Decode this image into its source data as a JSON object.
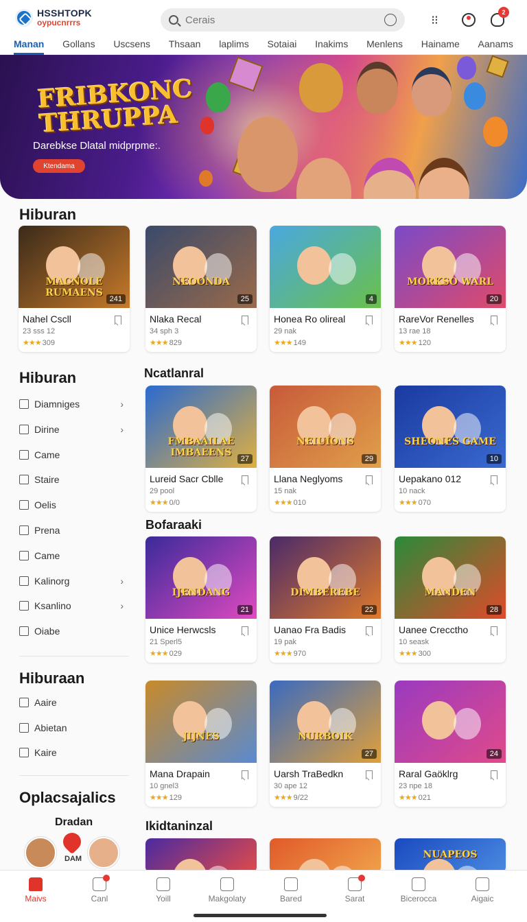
{
  "header": {
    "logo_top": "HSSHTOPK",
    "logo_bottom": "oypucnrrrs",
    "search_placeholder": "Cerais",
    "notification_count": "2",
    "tabs": [
      "Manan",
      "Gollans",
      "Uscsens",
      "Thsaan",
      "laplims",
      "Sotaiai",
      "Inakims",
      "Menlens",
      "Hainame",
      "Aanams"
    ]
  },
  "hero": {
    "title": "FRIBKONC THRUPPA",
    "subtitle": "Darebkse Dlatal midprpme:.",
    "button_label": "Ktendama"
  },
  "section1": {
    "title": "Hiburan"
  },
  "row1": [
    {
      "title": "Nahel Cscll",
      "meta": "23 sss 12",
      "rating": "309",
      "badge": "241",
      "thumb_text": "MACNOLE RUMAENS",
      "colors": [
        "#3a2a1a",
        "#c77a2a"
      ]
    },
    {
      "title": "Nlaka Recal",
      "meta": "34 sph 3",
      "rating": "829",
      "badge": "25",
      "thumb_text": "NEOONDA",
      "colors": [
        "#3a4a6a",
        "#9a6a4a"
      ]
    },
    {
      "title": "Honea Ro olireal",
      "meta": "29 nak",
      "rating": "149",
      "badge": "4",
      "thumb_text": "",
      "colors": [
        "#4aa8e0",
        "#6ac04a"
      ]
    },
    {
      "title": "RareVor Renelles",
      "meta": "13 rae 18",
      "rating": "120",
      "badge": "20",
      "thumb_text": "MORKSO WARL",
      "colors": [
        "#7a4ac8",
        "#e04a6a"
      ]
    }
  ],
  "sidebar1": {
    "title": "Hiburan",
    "items": [
      {
        "label": "Diamniges",
        "chevron": true
      },
      {
        "label": "Dirine",
        "chevron": true
      },
      {
        "label": "Came",
        "chevron": false
      },
      {
        "label": "Staire",
        "chevron": false
      },
      {
        "label": "Oelis",
        "chevron": false
      },
      {
        "label": "Prena",
        "chevron": false
      },
      {
        "label": "Came",
        "chevron": false
      },
      {
        "label": "Kalinorg",
        "chevron": true
      },
      {
        "label": "Ksanlino",
        "chevron": true
      },
      {
        "label": "Oiabe",
        "chevron": false
      }
    ]
  },
  "sidebar2": {
    "title": "Hiburaan",
    "items": [
      {
        "label": "Aaire"
      },
      {
        "label": "Abietan"
      },
      {
        "label": "Kaire"
      }
    ]
  },
  "sidebar3": {
    "title": "Oplacsajalics",
    "sub": "Dradan",
    "avatar_label": "DAM"
  },
  "sub_section2": {
    "title": "Ncatlanral"
  },
  "row2": [
    {
      "title": "Lureid Sacr Cblle",
      "meta": "29 pool",
      "rating": "0/0",
      "badge": "27",
      "thumb_text": "FMBAAILAE IMBAEENS",
      "colors": [
        "#2a6ad0",
        "#e0b040"
      ]
    },
    {
      "title": "Llana Neglyoms",
      "meta": "15 nak",
      "rating": "010",
      "badge": "29",
      "thumb_text": "NEIUIONS",
      "colors": [
        "#c85a3a",
        "#e0a04a"
      ]
    },
    {
      "title": "Uepakano 012",
      "meta": "10 nack",
      "rating": "070",
      "badge": "10",
      "thumb_text": "SHEONES GAME",
      "colors": [
        "#1a3aa0",
        "#3a6ad0"
      ]
    }
  ],
  "sub_section3": {
    "title": "Bofaraaki"
  },
  "row3": [
    {
      "title": "Unice Herwcsls",
      "meta": "21 Sperl5",
      "rating": "029",
      "badge": "21",
      "thumb_text": "IJENDANG",
      "colors": [
        "#3a2a9a",
        "#e04ac0"
      ]
    },
    {
      "title": "Uanao Fra Badis",
      "meta": "19 pak",
      "rating": "970",
      "badge": "22",
      "thumb_text": "DIMBEREBE",
      "colors": [
        "#4a2a6a",
        "#e07a2a"
      ]
    },
    {
      "title": "Uanee Crecctho",
      "meta": "10 seask",
      "rating": "300",
      "badge": "28",
      "thumb_text": "MANDEN",
      "colors": [
        "#2a8a3a",
        "#e04a2a"
      ]
    }
  ],
  "row4": [
    {
      "title": "Mana Drapain",
      "meta": "10 gnel3",
      "rating": "129",
      "badge": "",
      "thumb_text": "JIJNES",
      "colors": [
        "#c88a2a",
        "#5a8ad0"
      ]
    },
    {
      "title": "Uarsh TraBedkn",
      "meta": "30 ape 12",
      "rating": "9/22",
      "badge": "27",
      "thumb_text": "NURBOIK",
      "colors": [
        "#3a6ac0",
        "#e0a03a"
      ]
    },
    {
      "title": "Raral Gaöklrg",
      "meta": "23 npe 18",
      "rating": "021",
      "badge": "24",
      "thumb_text": "",
      "colors": [
        "#9a3ac0",
        "#e04a8a"
      ]
    }
  ],
  "sub_section5": {
    "title": "Ikidtaninzal"
  },
  "row5": [
    {
      "thumb_text": "",
      "colors": [
        "#4a2aa0",
        "#e04a4a"
      ]
    },
    {
      "thumb_text": "",
      "colors": [
        "#e05a2a",
        "#f0a04a"
      ]
    },
    {
      "thumb_text": "NUAPEOS",
      "colors": [
        "#1a4ac0",
        "#4a8ae0"
      ]
    }
  ],
  "bottom_nav": [
    {
      "label": "Maivs",
      "icon": "home-icon",
      "active": true,
      "dot": false
    },
    {
      "label": "Canl",
      "icon": "clock-icon",
      "active": false,
      "dot": true
    },
    {
      "label": "Yoill",
      "icon": "star-icon",
      "active": false,
      "dot": false
    },
    {
      "label": "Makgolaty",
      "icon": "chat-icon",
      "active": false,
      "dot": false
    },
    {
      "label": "Bared",
      "icon": "box-icon",
      "active": false,
      "dot": false
    },
    {
      "label": "Sarat",
      "icon": "grid-icon",
      "active": false,
      "dot": true
    },
    {
      "label": "Bicerocca",
      "icon": "list-icon",
      "active": false,
      "dot": false
    },
    {
      "label": "Aigaic",
      "icon": "user-icon",
      "active": false,
      "dot": false
    }
  ]
}
